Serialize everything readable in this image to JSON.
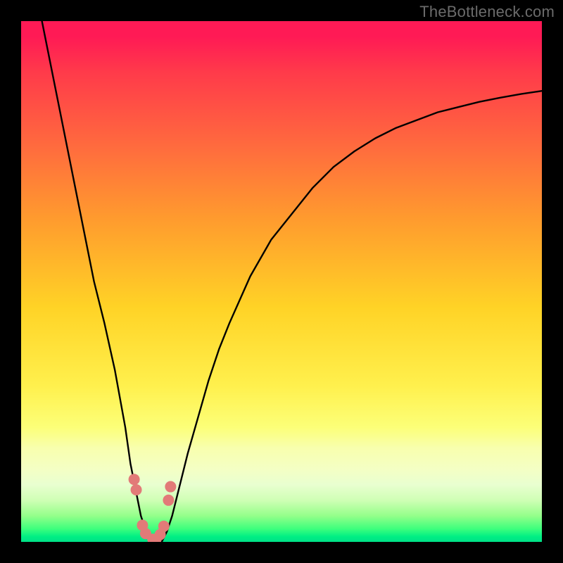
{
  "watermark": "TheBottleneck.com",
  "chart_data": {
    "type": "line",
    "title": "",
    "xlabel": "",
    "ylabel": "",
    "xlim": [
      0,
      100
    ],
    "ylim": [
      0,
      100
    ],
    "series": [
      {
        "name": "bottleneck-curve",
        "x": [
          4,
          6,
          8,
          10,
          12,
          14,
          16,
          18,
          20,
          21,
          22,
          23,
          24,
          25,
          26,
          27,
          28,
          29,
          30,
          32,
          34,
          36,
          38,
          40,
          44,
          48,
          52,
          56,
          60,
          64,
          68,
          72,
          76,
          80,
          84,
          88,
          92,
          96,
          100
        ],
        "values": [
          100,
          90,
          80,
          70,
          60,
          50,
          42,
          33,
          22,
          15,
          10,
          5,
          2,
          0,
          0,
          0,
          2,
          5,
          9,
          17,
          24,
          31,
          37,
          42,
          51,
          58,
          63,
          68,
          72,
          75,
          77.5,
          79.5,
          81,
          82.5,
          83.5,
          84.5,
          85.3,
          86,
          86.6
        ]
      },
      {
        "name": "valley-markers",
        "type": "scatter",
        "x": [
          21.7,
          22.1,
          23.3,
          23.9,
          25.3,
          25.9,
          26.7,
          27.4,
          28.3,
          28.7
        ],
        "values": [
          12.0,
          10.0,
          3.2,
          1.6,
          0.5,
          0.5,
          1.4,
          3.0,
          8.0,
          10.6
        ]
      }
    ],
    "colors": {
      "curve_stroke": "#000000",
      "marker_fill": "#e27a78",
      "gradient_top": "#ff1a55",
      "gradient_bottom": "#00e087"
    }
  }
}
